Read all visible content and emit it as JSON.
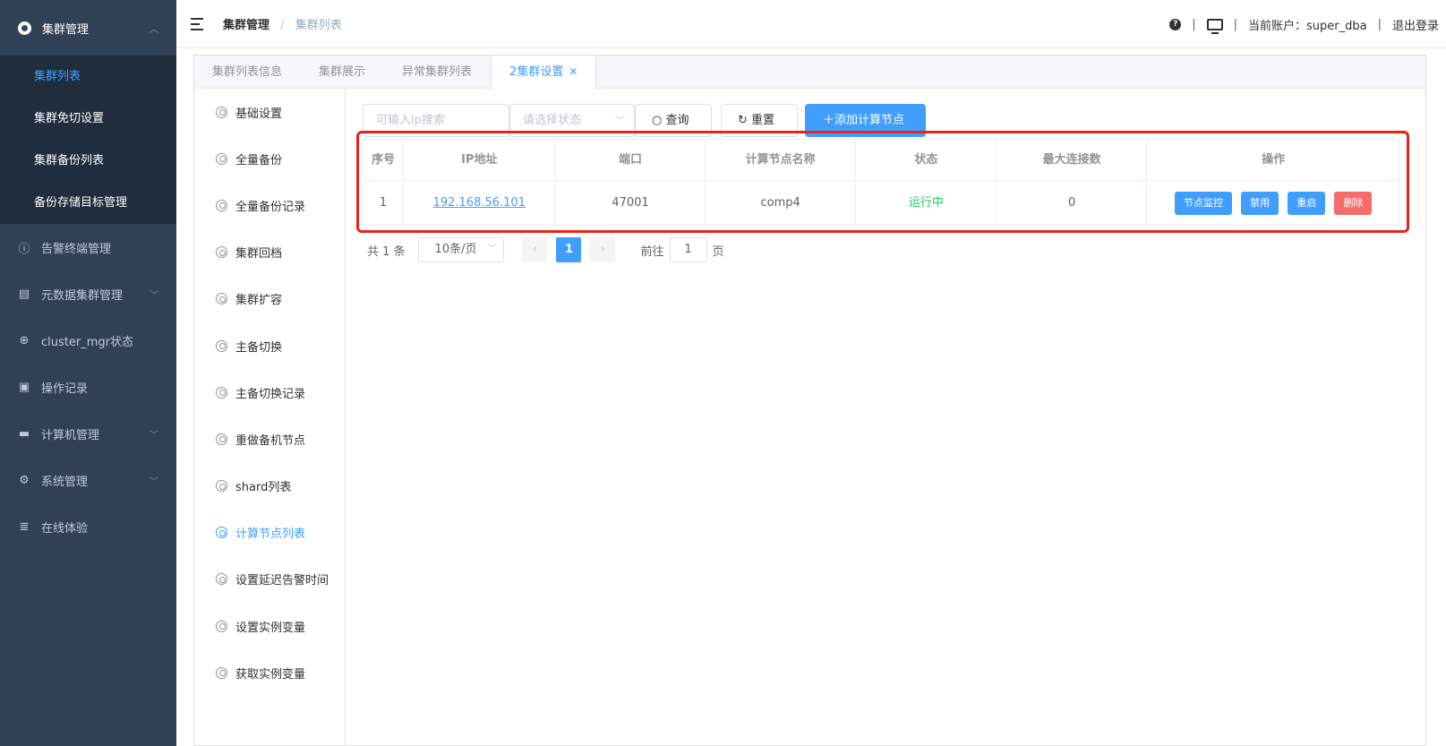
{
  "sidebar": {
    "top": {
      "label": "集群管理"
    },
    "sub_items": [
      "集群列表",
      "集群免切设置",
      "集群备份列表",
      "备份存储目标管理"
    ],
    "items": [
      {
        "label": "告警终端管理",
        "icon": "alert-circle-icon",
        "has_chevron": false
      },
      {
        "label": "元数据集群管理",
        "icon": "database-box-icon",
        "has_chevron": true
      },
      {
        "label": "cluster_mgr状态",
        "icon": "crosshair-icon",
        "has_chevron": false
      },
      {
        "label": "操作记录",
        "icon": "document-edit-icon",
        "has_chevron": false
      },
      {
        "label": "计算机管理",
        "icon": "monitor-icon",
        "has_chevron": true
      },
      {
        "label": "系统管理",
        "icon": "gear-icon",
        "has_chevron": true
      },
      {
        "label": "在线体验",
        "icon": "database-icon",
        "has_chevron": false
      }
    ]
  },
  "header": {
    "breadcrumb": [
      "集群管理",
      "集群列表"
    ],
    "account_text": "当前账户：super_dba",
    "logout": "退出登录"
  },
  "tabs": [
    "集群列表信息",
    "集群展示",
    "异常集群列表",
    "2集群设置"
  ],
  "left_nav": [
    "基础设置",
    "全量备份",
    "全量备份记录",
    "集群回档",
    "集群扩容",
    "主备切换",
    "主备切换记录",
    "重做备机节点",
    "shard列表",
    "计算节点列表",
    "设置延迟告警时间",
    "设置实例变量",
    "获取实例变量"
  ],
  "toolbar": {
    "ip_placeholder": "可输入ip搜索",
    "status_placeholder": "请选择状态",
    "query": "查询",
    "reset": "重置",
    "add": "添加计算节点"
  },
  "table": {
    "headers": [
      "序号",
      "IP地址",
      "端口",
      "计算节点名称",
      "状态",
      "最大连接数",
      "操作"
    ],
    "rows": [
      {
        "idx": "1",
        "ip": "192.168.56.101",
        "port": "47001",
        "name": "comp4",
        "status": "运行中",
        "max_conn": "0"
      }
    ],
    "ops": [
      "节点监控",
      "禁用",
      "重启",
      "删除"
    ]
  },
  "pagination": {
    "total": "共 1 条",
    "page_size": "10条/页",
    "current": "1",
    "goto_label": "前往",
    "goto_value": "1",
    "page_suffix": "页"
  },
  "colors": {
    "primary": "#409eff",
    "danger": "#f56c6c",
    "success": "#13ce66",
    "sidebar": "#304156",
    "highlight": "#e8231c"
  }
}
